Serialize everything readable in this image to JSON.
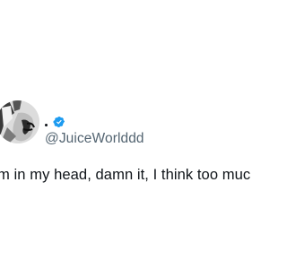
{
  "tweet": {
    "author": {
      "display_name": "",
      "handle": "@JuiceWorlddd",
      "verified": true,
      "verified_icon": "verified-badge-icon",
      "avatar_icon": "avatar-photo"
    },
    "text": "m in my head, damn it, I think too muc"
  },
  "colors": {
    "text_primary": "#0f1419",
    "text_secondary": "#536471",
    "verified_blue": "#1d9bf0",
    "background": "#ffffff"
  }
}
